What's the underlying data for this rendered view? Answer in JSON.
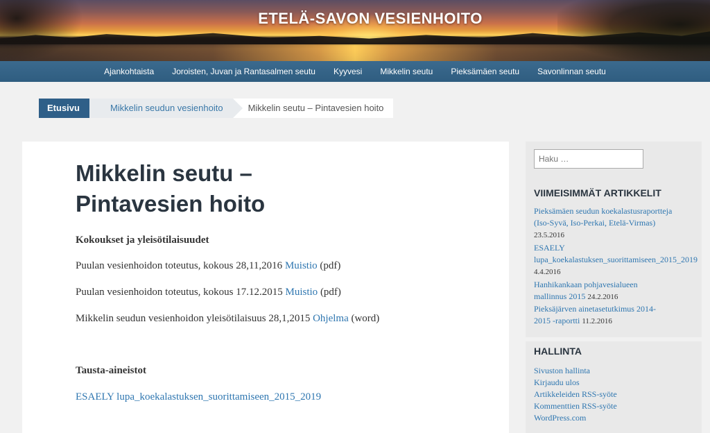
{
  "header": {
    "site_title": "ETELÄ-SAVON VESIENHOITO"
  },
  "nav": {
    "items": [
      "Ajankohtaista",
      "Joroisten, Juvan ja Rantasalmen seutu",
      "Kyyvesi",
      "Mikkelin seutu",
      "Pieksämäen seutu",
      "Savonlinnan seutu"
    ]
  },
  "breadcrumb": {
    "home": "Etusivu",
    "parent": "Mikkelin seudun vesienhoito",
    "current": "Mikkelin seutu – Pintavesien hoito"
  },
  "article": {
    "title_line1": "Mikkelin seutu –",
    "title_line2": "Pintavesien hoito",
    "section1_heading": "Kokoukset ja yleisötilaisuudet",
    "rows": [
      {
        "text": "Puulan vesienhoidon toteutus, kokous 28,11,2016 ",
        "link": "Muistio",
        "suffix": " (pdf)"
      },
      {
        "text": "Puulan vesienhoidon toteutus, kokous 17.12.2015 ",
        "link": "Muistio",
        "suffix": " (pdf)"
      },
      {
        "text": "Mikkelin seudun vesienhoidon yleisötilaisuus 28,1,2015 ",
        "link": "Ohjelma",
        "suffix": " (word)"
      }
    ],
    "section2_heading": "Tausta-aineistot",
    "section2_link": "ESAELY lupa_koekalastuksen_suorittamiseen_2015_2019"
  },
  "sidebar": {
    "search_placeholder": "Haku …",
    "recent_heading": "VIIMEISIMMÄT ARTIKKELIT",
    "recent": [
      {
        "title_l1": "Pieksämäen seudun koekalastusraportteja",
        "title_l2": "(Iso-Syvä, Iso-Perkai, Etelä-Virmas)",
        "date": "23.5.2016"
      },
      {
        "title_l1": "ESAELY",
        "title_l2": "lupa_koekalastuksen_suorittamiseen_2015_2019",
        "date": "4.4.2016"
      },
      {
        "title_l1": "Hanhikankaan pohjavesialueen",
        "title_l2": "mallinnus 2015",
        "date": "24.2.2016"
      },
      {
        "title_l1": "Pieksäjärven ainetasetutkimus 2014-",
        "title_l2": "2015 -raportti",
        "date": "11.2.2016"
      }
    ],
    "admin_heading": "HALLINTA",
    "admin_links": [
      "Sivuston hallinta",
      "Kirjaudu ulos",
      "Artikkeleiden RSS-syöte",
      "Kommenttien RSS-syöte",
      "WordPress.com"
    ]
  }
}
